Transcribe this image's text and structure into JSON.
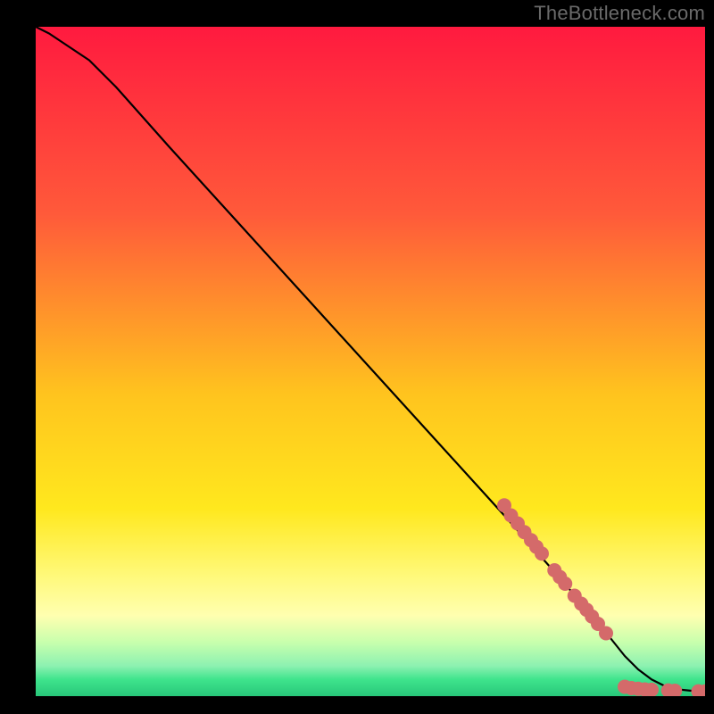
{
  "attribution": "TheBottleneck.com",
  "chart_data": {
    "type": "line",
    "title": "",
    "xlabel": "",
    "ylabel": "",
    "xlim": [
      0,
      100
    ],
    "ylim": [
      0,
      100
    ],
    "background_gradient": {
      "stops": [
        {
          "offset": 0.0,
          "color": "#ff1a3f"
        },
        {
          "offset": 0.28,
          "color": "#ff5a3a"
        },
        {
          "offset": 0.55,
          "color": "#ffc41e"
        },
        {
          "offset": 0.72,
          "color": "#ffe81e"
        },
        {
          "offset": 0.82,
          "color": "#fff97a"
        },
        {
          "offset": 0.88,
          "color": "#ffffb0"
        },
        {
          "offset": 0.92,
          "color": "#c7ffad"
        },
        {
          "offset": 0.955,
          "color": "#8cf1b1"
        },
        {
          "offset": 0.975,
          "color": "#3fe48c"
        },
        {
          "offset": 1.0,
          "color": "#28c77a"
        }
      ]
    },
    "series": [
      {
        "name": "bottleneck-curve",
        "x": [
          0,
          2,
          5,
          8,
          12,
          20,
          30,
          40,
          50,
          60,
          70,
          78,
          84,
          88,
          90,
          92,
          94,
          96,
          98,
          100
        ],
        "y": [
          100,
          99,
          97,
          95,
          91,
          82,
          71,
          60,
          49,
          38,
          27,
          18,
          11,
          6,
          4,
          2.5,
          1.5,
          1,
          0.8,
          0.7
        ]
      }
    ],
    "scatter": {
      "name": "marker-dots",
      "color": "#d46a6a",
      "radius": 8,
      "points": [
        {
          "x": 70.0,
          "y": 28.5
        },
        {
          "x": 71.0,
          "y": 27.0
        },
        {
          "x": 72.0,
          "y": 25.8
        },
        {
          "x": 73.0,
          "y": 24.5
        },
        {
          "x": 74.0,
          "y": 23.3
        },
        {
          "x": 74.8,
          "y": 22.3
        },
        {
          "x": 75.6,
          "y": 21.3
        },
        {
          "x": 77.5,
          "y": 18.8
        },
        {
          "x": 78.3,
          "y": 17.8
        },
        {
          "x": 79.1,
          "y": 16.8
        },
        {
          "x": 80.5,
          "y": 15.0
        },
        {
          "x": 81.5,
          "y": 13.8
        },
        {
          "x": 82.3,
          "y": 12.9
        },
        {
          "x": 83.1,
          "y": 11.9
        },
        {
          "x": 84.0,
          "y": 10.8
        },
        {
          "x": 85.2,
          "y": 9.4
        },
        {
          "x": 88.0,
          "y": 1.4
        },
        {
          "x": 89.0,
          "y": 1.2
        },
        {
          "x": 90.0,
          "y": 1.1
        },
        {
          "x": 91.0,
          "y": 1.0
        },
        {
          "x": 92.0,
          "y": 0.95
        },
        {
          "x": 94.5,
          "y": 0.85
        },
        {
          "x": 95.5,
          "y": 0.8
        },
        {
          "x": 99.0,
          "y": 0.72
        },
        {
          "x": 100.0,
          "y": 0.7
        }
      ]
    }
  }
}
